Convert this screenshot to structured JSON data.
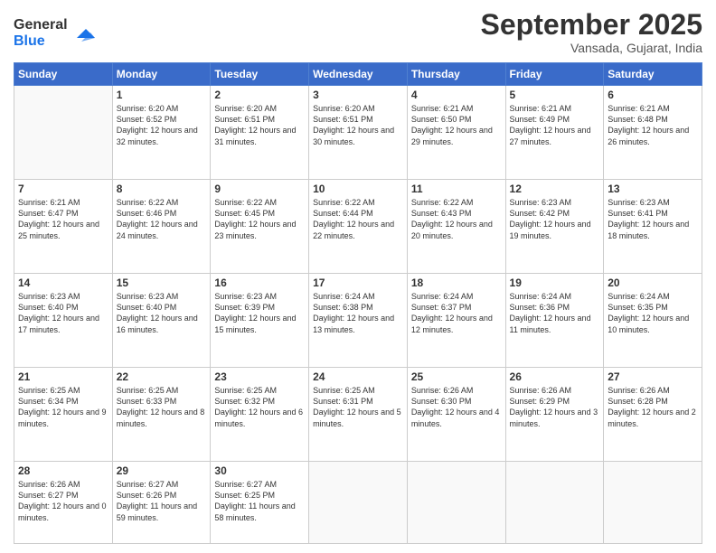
{
  "header": {
    "logo_line1": "General",
    "logo_line2": "Blue",
    "month": "September 2025",
    "location": "Vansada, Gujarat, India"
  },
  "days": [
    "Sunday",
    "Monday",
    "Tuesday",
    "Wednesday",
    "Thursday",
    "Friday",
    "Saturday"
  ],
  "weeks": [
    [
      {
        "day": "",
        "sunrise": "",
        "sunset": "",
        "daylight": ""
      },
      {
        "day": "1",
        "sunrise": "Sunrise: 6:20 AM",
        "sunset": "Sunset: 6:52 PM",
        "daylight": "Daylight: 12 hours and 32 minutes."
      },
      {
        "day": "2",
        "sunrise": "Sunrise: 6:20 AM",
        "sunset": "Sunset: 6:51 PM",
        "daylight": "Daylight: 12 hours and 31 minutes."
      },
      {
        "day": "3",
        "sunrise": "Sunrise: 6:20 AM",
        "sunset": "Sunset: 6:51 PM",
        "daylight": "Daylight: 12 hours and 30 minutes."
      },
      {
        "day": "4",
        "sunrise": "Sunrise: 6:21 AM",
        "sunset": "Sunset: 6:50 PM",
        "daylight": "Daylight: 12 hours and 29 minutes."
      },
      {
        "day": "5",
        "sunrise": "Sunrise: 6:21 AM",
        "sunset": "Sunset: 6:49 PM",
        "daylight": "Daylight: 12 hours and 27 minutes."
      },
      {
        "day": "6",
        "sunrise": "Sunrise: 6:21 AM",
        "sunset": "Sunset: 6:48 PM",
        "daylight": "Daylight: 12 hours and 26 minutes."
      }
    ],
    [
      {
        "day": "7",
        "sunrise": "Sunrise: 6:21 AM",
        "sunset": "Sunset: 6:47 PM",
        "daylight": "Daylight: 12 hours and 25 minutes."
      },
      {
        "day": "8",
        "sunrise": "Sunrise: 6:22 AM",
        "sunset": "Sunset: 6:46 PM",
        "daylight": "Daylight: 12 hours and 24 minutes."
      },
      {
        "day": "9",
        "sunrise": "Sunrise: 6:22 AM",
        "sunset": "Sunset: 6:45 PM",
        "daylight": "Daylight: 12 hours and 23 minutes."
      },
      {
        "day": "10",
        "sunrise": "Sunrise: 6:22 AM",
        "sunset": "Sunset: 6:44 PM",
        "daylight": "Daylight: 12 hours and 22 minutes."
      },
      {
        "day": "11",
        "sunrise": "Sunrise: 6:22 AM",
        "sunset": "Sunset: 6:43 PM",
        "daylight": "Daylight: 12 hours and 20 minutes."
      },
      {
        "day": "12",
        "sunrise": "Sunrise: 6:23 AM",
        "sunset": "Sunset: 6:42 PM",
        "daylight": "Daylight: 12 hours and 19 minutes."
      },
      {
        "day": "13",
        "sunrise": "Sunrise: 6:23 AM",
        "sunset": "Sunset: 6:41 PM",
        "daylight": "Daylight: 12 hours and 18 minutes."
      }
    ],
    [
      {
        "day": "14",
        "sunrise": "Sunrise: 6:23 AM",
        "sunset": "Sunset: 6:40 PM",
        "daylight": "Daylight: 12 hours and 17 minutes."
      },
      {
        "day": "15",
        "sunrise": "Sunrise: 6:23 AM",
        "sunset": "Sunset: 6:40 PM",
        "daylight": "Daylight: 12 hours and 16 minutes."
      },
      {
        "day": "16",
        "sunrise": "Sunrise: 6:23 AM",
        "sunset": "Sunset: 6:39 PM",
        "daylight": "Daylight: 12 hours and 15 minutes."
      },
      {
        "day": "17",
        "sunrise": "Sunrise: 6:24 AM",
        "sunset": "Sunset: 6:38 PM",
        "daylight": "Daylight: 12 hours and 13 minutes."
      },
      {
        "day": "18",
        "sunrise": "Sunrise: 6:24 AM",
        "sunset": "Sunset: 6:37 PM",
        "daylight": "Daylight: 12 hours and 12 minutes."
      },
      {
        "day": "19",
        "sunrise": "Sunrise: 6:24 AM",
        "sunset": "Sunset: 6:36 PM",
        "daylight": "Daylight: 12 hours and 11 minutes."
      },
      {
        "day": "20",
        "sunrise": "Sunrise: 6:24 AM",
        "sunset": "Sunset: 6:35 PM",
        "daylight": "Daylight: 12 hours and 10 minutes."
      }
    ],
    [
      {
        "day": "21",
        "sunrise": "Sunrise: 6:25 AM",
        "sunset": "Sunset: 6:34 PM",
        "daylight": "Daylight: 12 hours and 9 minutes."
      },
      {
        "day": "22",
        "sunrise": "Sunrise: 6:25 AM",
        "sunset": "Sunset: 6:33 PM",
        "daylight": "Daylight: 12 hours and 8 minutes."
      },
      {
        "day": "23",
        "sunrise": "Sunrise: 6:25 AM",
        "sunset": "Sunset: 6:32 PM",
        "daylight": "Daylight: 12 hours and 6 minutes."
      },
      {
        "day": "24",
        "sunrise": "Sunrise: 6:25 AM",
        "sunset": "Sunset: 6:31 PM",
        "daylight": "Daylight: 12 hours and 5 minutes."
      },
      {
        "day": "25",
        "sunrise": "Sunrise: 6:26 AM",
        "sunset": "Sunset: 6:30 PM",
        "daylight": "Daylight: 12 hours and 4 minutes."
      },
      {
        "day": "26",
        "sunrise": "Sunrise: 6:26 AM",
        "sunset": "Sunset: 6:29 PM",
        "daylight": "Daylight: 12 hours and 3 minutes."
      },
      {
        "day": "27",
        "sunrise": "Sunrise: 6:26 AM",
        "sunset": "Sunset: 6:28 PM",
        "daylight": "Daylight: 12 hours and 2 minutes."
      }
    ],
    [
      {
        "day": "28",
        "sunrise": "Sunrise: 6:26 AM",
        "sunset": "Sunset: 6:27 PM",
        "daylight": "Daylight: 12 hours and 0 minutes."
      },
      {
        "day": "29",
        "sunrise": "Sunrise: 6:27 AM",
        "sunset": "Sunset: 6:26 PM",
        "daylight": "Daylight: 11 hours and 59 minutes."
      },
      {
        "day": "30",
        "sunrise": "Sunrise: 6:27 AM",
        "sunset": "Sunset: 6:25 PM",
        "daylight": "Daylight: 11 hours and 58 minutes."
      },
      {
        "day": "",
        "sunrise": "",
        "sunset": "",
        "daylight": ""
      },
      {
        "day": "",
        "sunrise": "",
        "sunset": "",
        "daylight": ""
      },
      {
        "day": "",
        "sunrise": "",
        "sunset": "",
        "daylight": ""
      },
      {
        "day": "",
        "sunrise": "",
        "sunset": "",
        "daylight": ""
      }
    ]
  ]
}
